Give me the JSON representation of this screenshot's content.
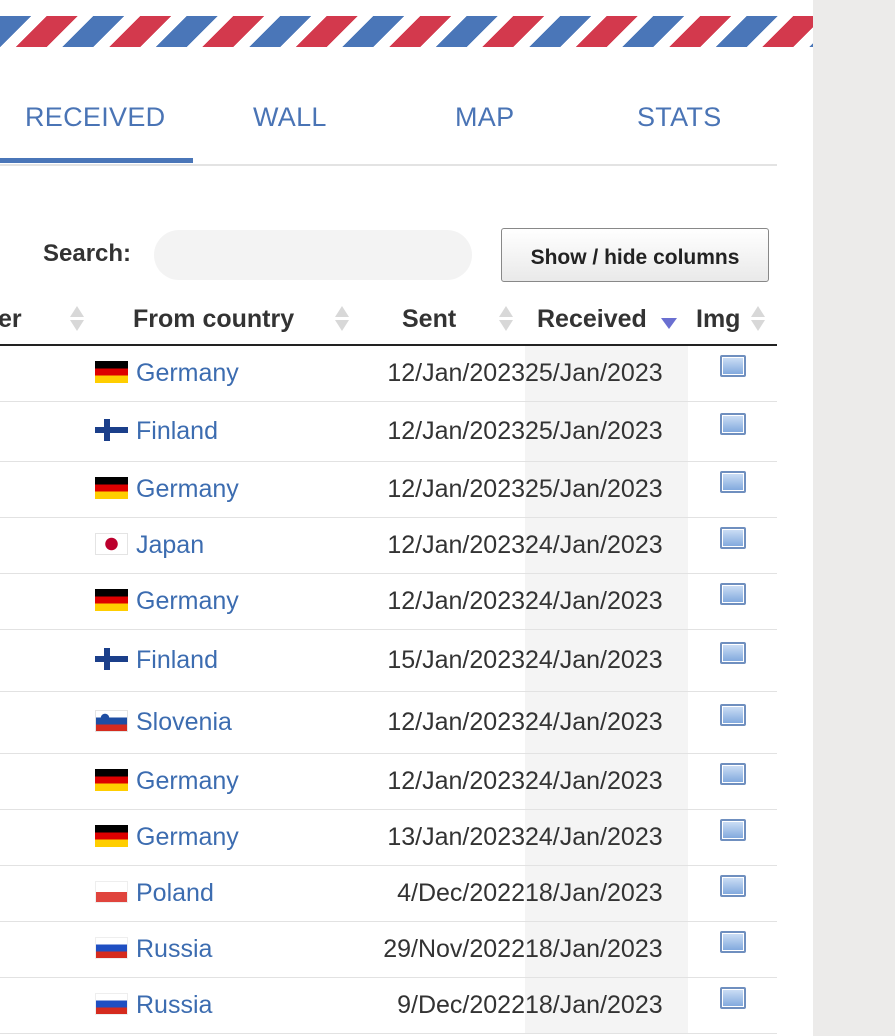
{
  "tabs": [
    {
      "label": "RECEIVED",
      "active": true
    },
    {
      "label": "WALL",
      "active": false
    },
    {
      "label": "MAP",
      "active": false
    },
    {
      "label": "STATS",
      "active": false
    }
  ],
  "search": {
    "label": "Search:",
    "value": "",
    "placeholder": ""
  },
  "columns_button": "Show / hide columns",
  "table": {
    "headers": {
      "sender": "er",
      "country": "From country",
      "sent": "Sent",
      "received": "Received",
      "img": "Img"
    },
    "sorted_by": "Received",
    "sort_direction": "descending",
    "rows": [
      {
        "country": "Germany",
        "flag": "de",
        "sent": "12/Jan/2023",
        "received": "25/Jan/2023",
        "img_icon": "image-icon"
      },
      {
        "country": "Finland",
        "flag": "fi",
        "sent": "12/Jan/2023",
        "received": "25/Jan/2023",
        "img_icon": "image-icon"
      },
      {
        "country": "Germany",
        "flag": "de",
        "sent": "12/Jan/2023",
        "received": "25/Jan/2023",
        "img_icon": "image-icon"
      },
      {
        "country": "Japan",
        "flag": "jp",
        "sent": "12/Jan/2023",
        "received": "24/Jan/2023",
        "img_icon": "image-icon"
      },
      {
        "country": "Germany",
        "flag": "de",
        "sent": "12/Jan/2023",
        "received": "24/Jan/2023",
        "img_icon": "image-icon"
      },
      {
        "country": "Finland",
        "flag": "fi",
        "sent": "15/Jan/2023",
        "received": "24/Jan/2023",
        "img_icon": "image-icon"
      },
      {
        "country": "Slovenia",
        "flag": "si",
        "sent": "12/Jan/2023",
        "received": "24/Jan/2023",
        "img_icon": "image-icon"
      },
      {
        "country": "Germany",
        "flag": "de",
        "sent": "12/Jan/2023",
        "received": "24/Jan/2023",
        "img_icon": "image-icon"
      },
      {
        "country": "Germany",
        "flag": "de",
        "sent": "13/Jan/2023",
        "received": "24/Jan/2023",
        "img_icon": "image-icon"
      },
      {
        "country": "Poland",
        "flag": "pl",
        "sent": "4/Dec/2022",
        "received": "18/Jan/2023",
        "img_icon": "image-icon"
      },
      {
        "country": "Russia",
        "flag": "ru",
        "sent": "29/Nov/2022",
        "received": "18/Jan/2023",
        "img_icon": "image-icon"
      },
      {
        "country": "Russia",
        "flag": "ru",
        "sent": "9/Dec/2022",
        "received": "18/Jan/2023",
        "img_icon": "image-icon"
      }
    ]
  },
  "colors": {
    "accent_blue": "#4a76b8",
    "airmail_red": "#d3394d",
    "link": "#3c6cb0",
    "sort_arrow": "#6a6fd1"
  }
}
